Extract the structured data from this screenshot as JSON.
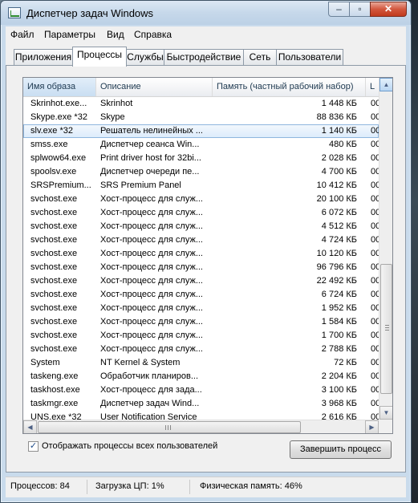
{
  "window": {
    "title": "Диспетчер задач Windows"
  },
  "menu": [
    "Файл",
    "Параметры",
    "Вид",
    "Справка"
  ],
  "tabs": [
    "Приложения",
    "Процессы",
    "Службы",
    "Быстродействие",
    "Сеть",
    "Пользователи"
  ],
  "active_tab": "Процессы",
  "columns": {
    "name": "Имя образа",
    "description": "Описание",
    "memory": "Память (частный рабочий набор)",
    "extra": "L"
  },
  "rows": [
    {
      "name": "Skrinhot.exe...",
      "description": "Skrinhot",
      "memory": "1 448 КБ",
      "extra": "00"
    },
    {
      "name": "Skype.exe *32",
      "description": "Skype",
      "memory": "88 836 КБ",
      "extra": "00"
    },
    {
      "name": "slv.exe *32",
      "description": "Решатель нелинейных ...",
      "memory": "1 140 КБ",
      "extra": "00",
      "selected": true
    },
    {
      "name": "smss.exe",
      "description": "Диспетчер сеанса  Win...",
      "memory": "480 КБ",
      "extra": "00"
    },
    {
      "name": "splwow64.exe",
      "description": "Print driver host for 32bi...",
      "memory": "2 028 КБ",
      "extra": "00"
    },
    {
      "name": "spoolsv.exe",
      "description": "Диспетчер очереди пе...",
      "memory": "4 700 КБ",
      "extra": "00"
    },
    {
      "name": "SRSPremium...",
      "description": "SRS Premium Panel",
      "memory": "10 412 КБ",
      "extra": "00"
    },
    {
      "name": "svchost.exe",
      "description": "Хост-процесс для служ...",
      "memory": "20 100 КБ",
      "extra": "00"
    },
    {
      "name": "svchost.exe",
      "description": "Хост-процесс для служ...",
      "memory": "6 072 КБ",
      "extra": "00"
    },
    {
      "name": "svchost.exe",
      "description": "Хост-процесс для служ...",
      "memory": "4 512 КБ",
      "extra": "00"
    },
    {
      "name": "svchost.exe",
      "description": "Хост-процесс для служ...",
      "memory": "4 724 КБ",
      "extra": "00"
    },
    {
      "name": "svchost.exe",
      "description": "Хост-процесс для служ...",
      "memory": "10 120 КБ",
      "extra": "00"
    },
    {
      "name": "svchost.exe",
      "description": "Хост-процесс для служ...",
      "memory": "96 796 КБ",
      "extra": "00"
    },
    {
      "name": "svchost.exe",
      "description": "Хост-процесс для служ...",
      "memory": "22 492 КБ",
      "extra": "00"
    },
    {
      "name": "svchost.exe",
      "description": "Хост-процесс для служ...",
      "memory": "6 724 КБ",
      "extra": "00"
    },
    {
      "name": "svchost.exe",
      "description": "Хост-процесс для служ...",
      "memory": "1 952 КБ",
      "extra": "00"
    },
    {
      "name": "svchost.exe",
      "description": "Хост-процесс для служ...",
      "memory": "1 584 КБ",
      "extra": "00"
    },
    {
      "name": "svchost.exe",
      "description": "Хост-процесс для служ...",
      "memory": "1 700 КБ",
      "extra": "00"
    },
    {
      "name": "svchost.exe",
      "description": "Хост-процесс для служ...",
      "memory": "2 788 КБ",
      "extra": "00"
    },
    {
      "name": "System",
      "description": "NT Kernel & System",
      "memory": "72 КБ",
      "extra": "00"
    },
    {
      "name": "taskeng.exe",
      "description": "Обработчик планиров...",
      "memory": "2 204 КБ",
      "extra": "00"
    },
    {
      "name": "taskhost.exe",
      "description": "Хост-процесс для зада...",
      "memory": "3 100 КБ",
      "extra": "00"
    },
    {
      "name": "taskmgr.exe",
      "description": "Диспетчер задач Wind...",
      "memory": "3 968 КБ",
      "extra": "00"
    },
    {
      "name": "UNS.exe *32",
      "description": "User Notification Service",
      "memory": "2 616 КБ",
      "extra": "00"
    }
  ],
  "show_all_users": {
    "label": "Отображать процессы всех пользователей",
    "checked": true
  },
  "end_process_label": "Завершить процесс",
  "status": {
    "processes": "Процессов: 84",
    "cpu": "Загрузка ЦП: 1%",
    "memory": "Физическая память: 46%"
  }
}
